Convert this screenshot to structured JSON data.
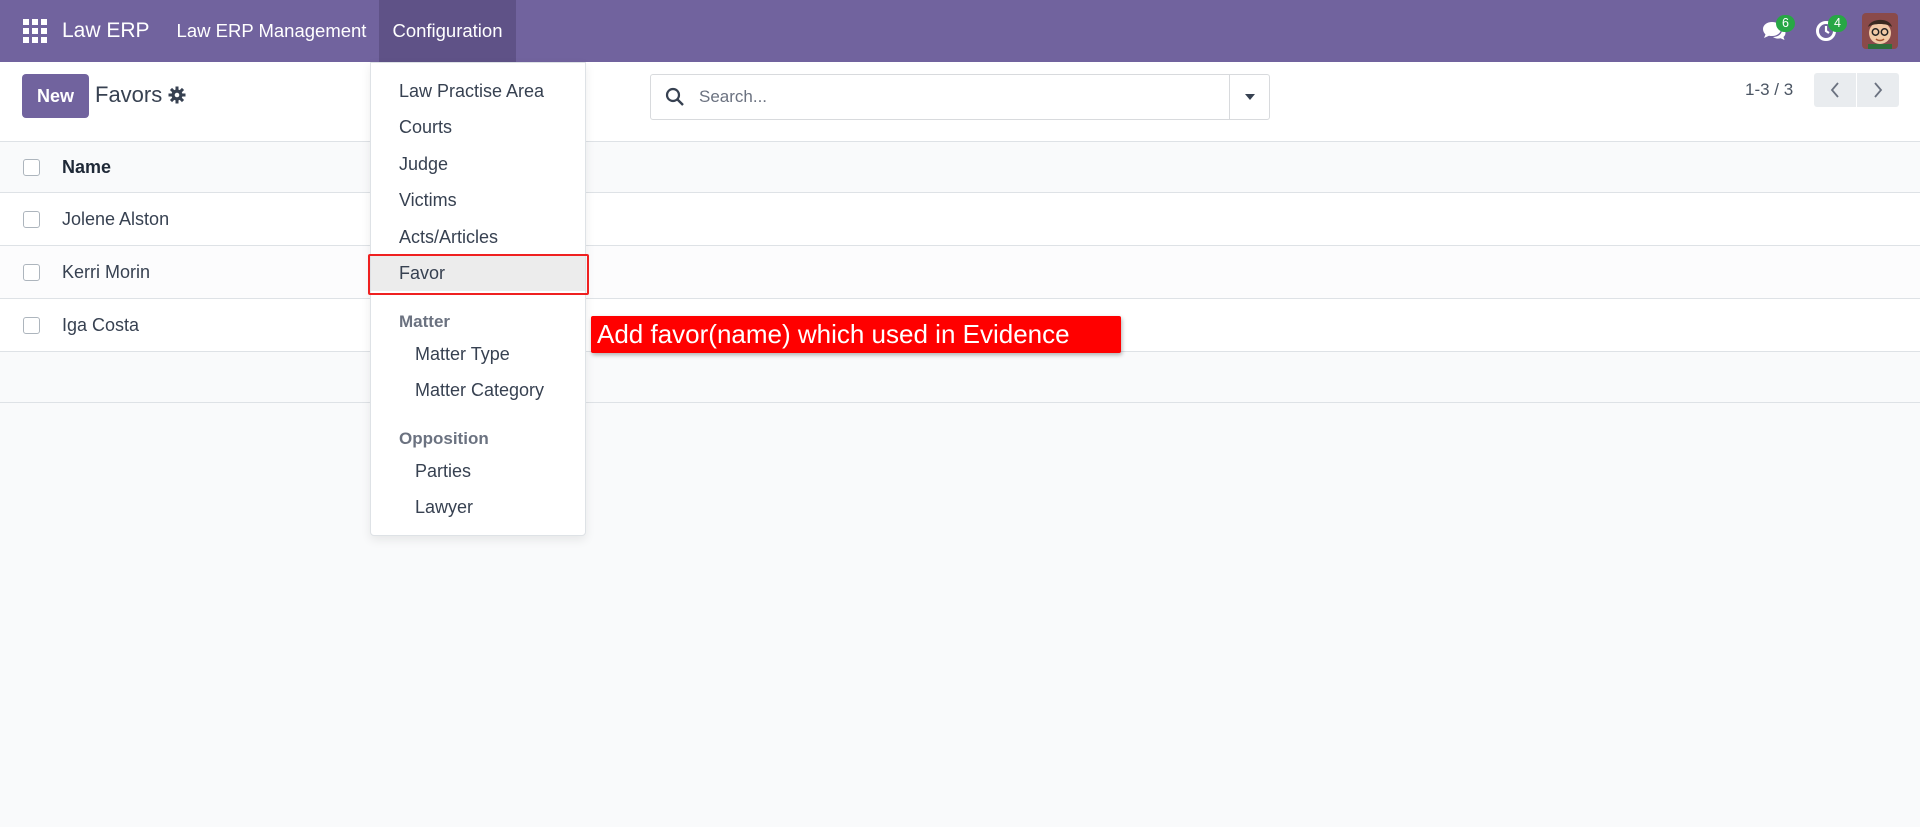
{
  "navbar": {
    "brand": "Law ERP",
    "menus": [
      "Law ERP Management",
      "Configuration"
    ],
    "messages_count": "6",
    "activities_count": "4"
  },
  "control": {
    "new_label": "New",
    "title": "Favors",
    "search_placeholder": "Search...",
    "pager": "1-3 / 3"
  },
  "list": {
    "column_header": "Name",
    "rows": [
      "Jolene Alston",
      "Kerri Morin",
      "Iga Costa"
    ]
  },
  "config_menu": {
    "items": [
      "Law Practise Area",
      "Courts",
      "Judge",
      "Victims",
      "Acts/Articles",
      "Favor"
    ],
    "selected": "Favor",
    "matter_header": "Matter",
    "matter_items": [
      "Matter Type",
      "Matter Category"
    ],
    "opposition_header": "Opposition",
    "opposition_items": [
      "Parties",
      "Lawyer"
    ]
  },
  "annotation": "Add favor(name) which used in Evidence",
  "colors": {
    "brand": "#71639e",
    "badge": "#28a745",
    "annotation": "#ff0000"
  }
}
